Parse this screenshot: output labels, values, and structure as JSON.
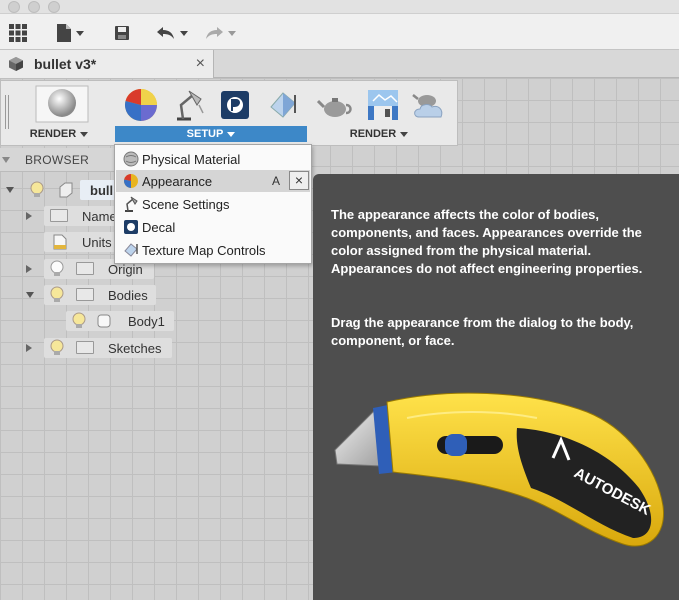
{
  "document": {
    "tab_title": "bullet v3*"
  },
  "ribbon": {
    "groups": [
      {
        "label": "RENDER"
      },
      {
        "label": "SETUP"
      },
      {
        "label": "RENDER"
      }
    ]
  },
  "browser": {
    "title": "BROWSER",
    "root_label": "bull",
    "nodes": [
      {
        "label": "Name"
      },
      {
        "label": "Units"
      },
      {
        "label": "Origin"
      },
      {
        "label": "Bodies"
      },
      {
        "label": "Body1"
      },
      {
        "label": "Sketches"
      }
    ]
  },
  "setup_menu": {
    "items": [
      {
        "label": "Physical Material",
        "icon": "sphere-material-icon"
      },
      {
        "label": "Appearance",
        "icon": "appearance-ball-icon",
        "shortcut": "A"
      },
      {
        "label": "Scene Settings",
        "icon": "scene-lamp-icon"
      },
      {
        "label": "Decal",
        "icon": "decal-icon"
      },
      {
        "label": "Texture Map Controls",
        "icon": "texture-map-icon"
      }
    ],
    "pin_close": "×"
  },
  "tooltip": {
    "paragraph1": "The appearance affects the color of bodies, components, and faces. Appearances override the color assigned from the physical material. Appearances do not affect engineering properties.",
    "paragraph2": "Drag the appearance from the dialog to the body, component, or face.",
    "image_brand": "AUTODESK"
  },
  "colors": {
    "accent": "#3d88c8",
    "tooltip_bg": "#4e4e4e",
    "knife_yellow": "#f2c817"
  }
}
